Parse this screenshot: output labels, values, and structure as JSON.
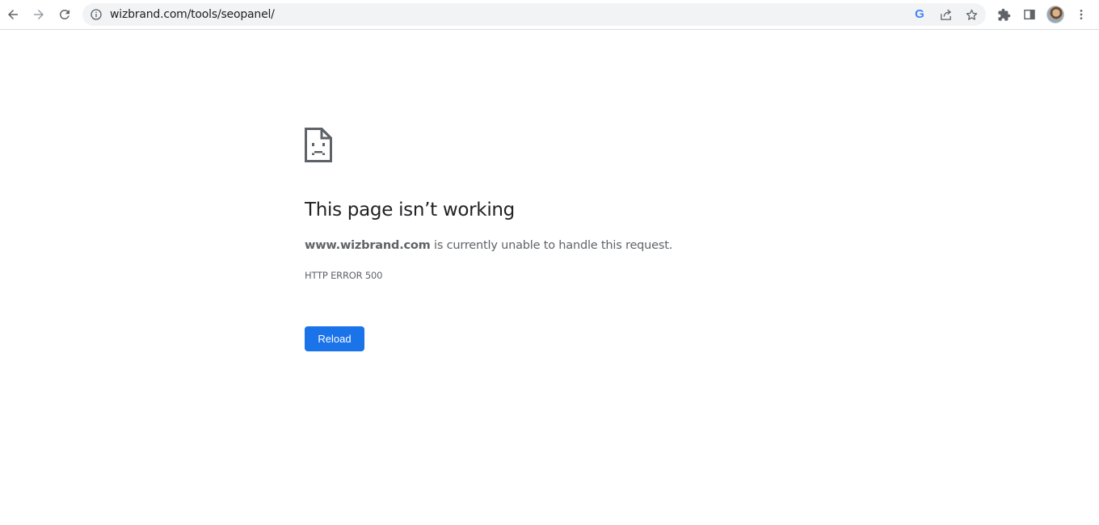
{
  "browser": {
    "url": "wizbrand.com/tools/seopanel/",
    "google_icon_letter": "G",
    "icons": {
      "back": "arrow-left-icon",
      "forward": "arrow-right-icon",
      "reload": "reload-icon",
      "site_info": "info-circle-icon",
      "google_lens": "google-icon",
      "share": "share-icon",
      "bookmark": "star-icon",
      "extensions": "puzzle-icon",
      "side_panel": "side-panel-icon",
      "profile": "avatar",
      "menu": "kebab-menu-icon"
    }
  },
  "error": {
    "title": "This page isn’t working",
    "domain": "www.wizbrand.com",
    "message": " is currently unable to handle this request.",
    "code": "HTTP ERROR 500",
    "reload_label": "Reload"
  },
  "colors": {
    "primary_button": "#1a73e8",
    "text_primary": "#202124",
    "text_secondary": "#5f6368",
    "omnibox_bg": "#f1f3f4"
  }
}
